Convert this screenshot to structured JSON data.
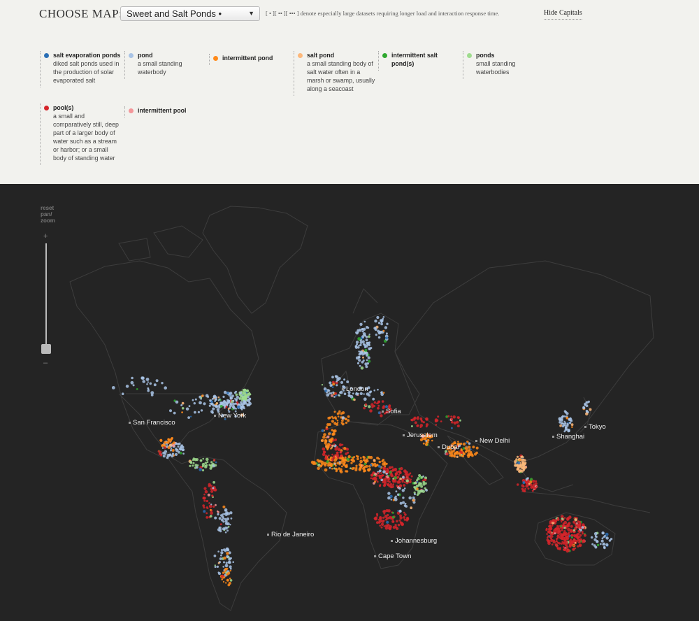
{
  "header": {
    "choose_label": "CHOOSE MAP:",
    "selected_map": "Sweet and Salt Ponds •",
    "size_note": "[ • ][ •• ][ ••• ] denote especially large datasets requiring longer load and interaction response time.",
    "hide_capitals": "Hide Capitals"
  },
  "legend": [
    {
      "title": "salt evaporation ponds",
      "desc": "diked salt ponds used in the production of solar evaporated salt",
      "color": "#2b6fb5"
    },
    {
      "title": "pond",
      "desc": "a small standing waterbody",
      "color": "#a9c4e6"
    },
    {
      "title": "intermittent pond",
      "desc": "",
      "color": "#ff8a1a"
    },
    {
      "title": "salt pond",
      "desc": "a small standing body of salt water often in a marsh or swamp, usually along a seacoast",
      "color": "#fdb87a"
    },
    {
      "title": "intermittent salt pond(s)",
      "desc": "",
      "color": "#2fa82f"
    },
    {
      "title": "ponds",
      "desc": "small standing waterbodies",
      "color": "#9fdc8e"
    },
    {
      "title": "pool(s)",
      "desc": "a small and comparatively still, deep part of a larger body of water such as a stream or harbor; or a small body of standing water",
      "color": "#d6252a"
    },
    {
      "title": "intermittent pool",
      "desc": "",
      "color": "#f4979a"
    }
  ],
  "zoom": {
    "reset_label": "reset pan/ zoom",
    "plus": "+",
    "minus": "–"
  },
  "capitals": [
    "San Francisco",
    "New York",
    "London",
    "Sofia",
    "Jerusalem",
    "Dubai",
    "New Delhi",
    "Shanghai",
    "Tokyo",
    "Rio de Janeiro",
    "Johannesburg",
    "Cape Town"
  ],
  "colors": {
    "map_bg": "#242424",
    "page_bg": "#f2f2ee",
    "coast": "#3d3d3d"
  }
}
